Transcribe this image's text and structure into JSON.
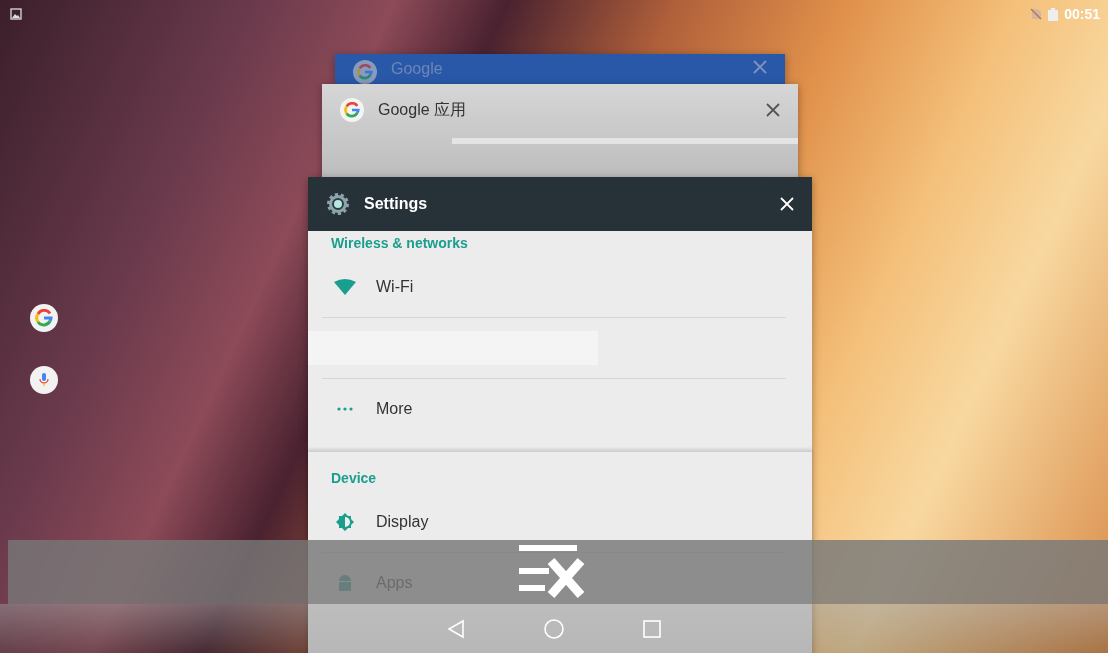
{
  "status_bar": {
    "time": "00:51"
  },
  "recent_apps": [
    {
      "kind": "google",
      "title": "Google"
    },
    {
      "kind": "google-app",
      "title": "Google 应用"
    },
    {
      "kind": "settings",
      "title": "Settings",
      "sections": [
        {
          "header": "Wireless & networks",
          "items": [
            {
              "kind": "wifi",
              "label": "Wi-Fi"
            },
            {
              "kind": "blank"
            },
            {
              "kind": "more",
              "label": "More"
            }
          ]
        },
        {
          "header": "Device",
          "items": [
            {
              "kind": "display",
              "label": "Display"
            },
            {
              "kind": "apps",
              "label": "Apps"
            }
          ]
        }
      ]
    }
  ]
}
